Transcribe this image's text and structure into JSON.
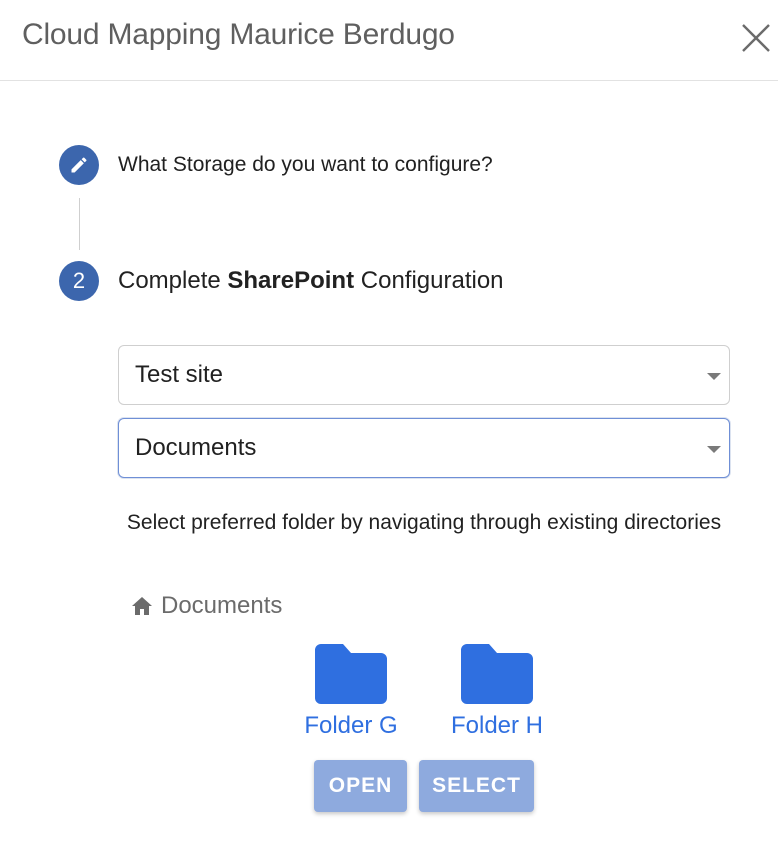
{
  "dialog": {
    "title": "Cloud Mapping Maurice Berdugo"
  },
  "steps": [
    {
      "icon": "pencil-icon",
      "label": "What Storage do you want to configure?"
    },
    {
      "number": "2",
      "label_prefix": "Complete ",
      "label_bold": "SharePoint",
      "label_suffix": " Configuration"
    }
  ],
  "selects": {
    "site": {
      "value": "Test site"
    },
    "library": {
      "value": "Documents"
    }
  },
  "instruction": "Select preferred folder by navigating through existing directories",
  "breadcrumb": {
    "icon": "home-icon",
    "label": "Documents"
  },
  "folders": [
    {
      "name": "Folder G",
      "icon": "folder-icon"
    },
    {
      "name": "Folder H",
      "icon": "folder-icon"
    }
  ],
  "buttons": {
    "open": "OPEN",
    "select": "SELECT"
  },
  "colors": {
    "step_circle": "#3c66ad",
    "folder": "#2f6fe0",
    "button_disabled": "#8eaade"
  }
}
